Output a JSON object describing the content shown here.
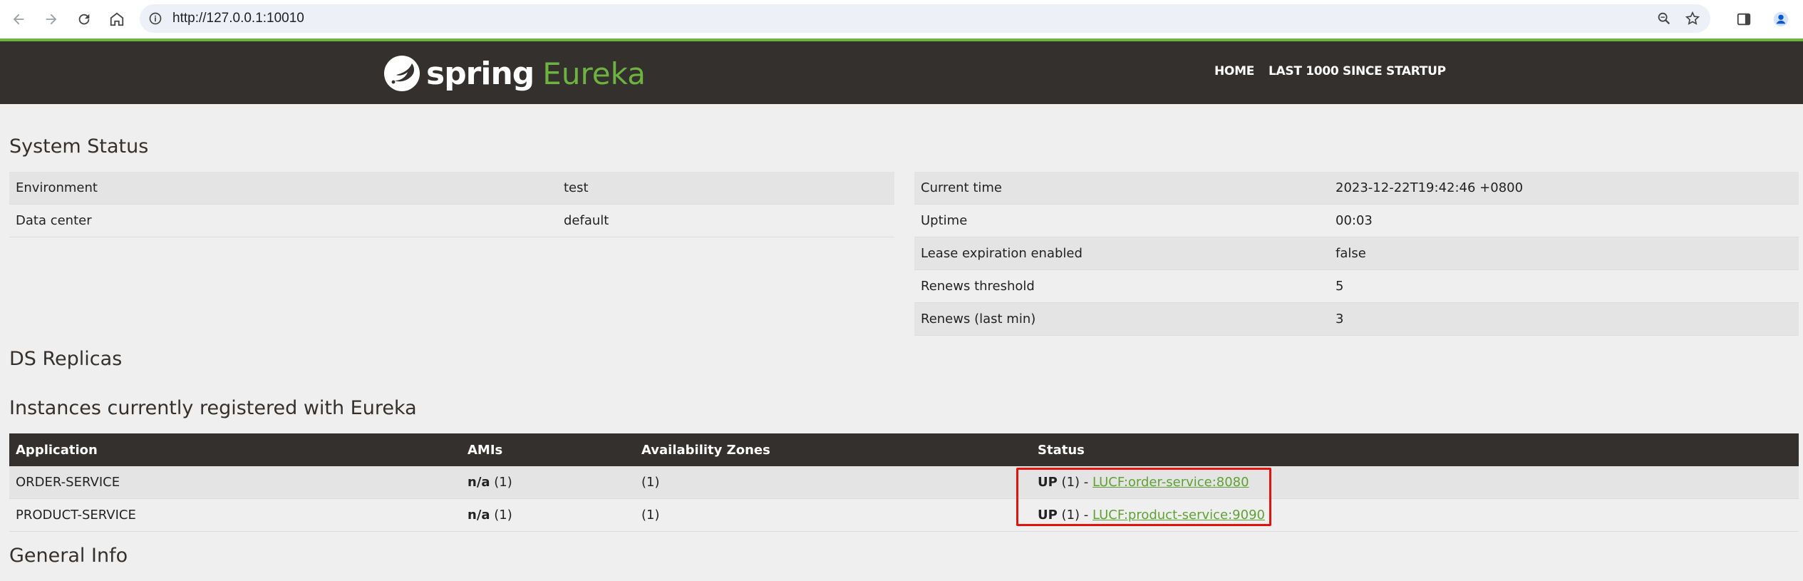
{
  "browser": {
    "url": "http://127.0.0.1:10010"
  },
  "navbar": {
    "brand_spring": "spring",
    "brand_eureka": "Eureka",
    "links": [
      "HOME",
      "LAST 1000 SINCE STARTUP"
    ]
  },
  "system_status": {
    "title": "System Status",
    "left": [
      {
        "label": "Environment",
        "value": "test"
      },
      {
        "label": "Data center",
        "value": "default"
      }
    ],
    "right": [
      {
        "label": "Current time",
        "value": "2023-12-22T19:42:46 +0800"
      },
      {
        "label": "Uptime",
        "value": "00:03"
      },
      {
        "label": "Lease expiration enabled",
        "value": "false"
      },
      {
        "label": "Renews threshold",
        "value": "5"
      },
      {
        "label": "Renews (last min)",
        "value": "3"
      }
    ]
  },
  "ds_replicas": {
    "title": "DS Replicas"
  },
  "instances": {
    "title": "Instances currently registered with Eureka",
    "headers": [
      "Application",
      "AMIs",
      "Availability Zones",
      "Status"
    ],
    "rows": [
      {
        "application": "ORDER-SERVICE",
        "amis_bold": "n/a",
        "amis_count": "(1)",
        "zones": "(1)",
        "status_bold": "UP",
        "status_count": "(1) -",
        "link": "LUCF:order-service:8080"
      },
      {
        "application": "PRODUCT-SERVICE",
        "amis_bold": "n/a",
        "amis_count": "(1)",
        "zones": "(1)",
        "status_bold": "UP",
        "status_count": "(1) -",
        "link": "LUCF:product-service:9090"
      }
    ]
  },
  "general_info": {
    "title": "General Info"
  },
  "colors": {
    "brand_green": "#6db33f",
    "header_dark": "#34302d",
    "highlight_red": "#e0140f"
  }
}
